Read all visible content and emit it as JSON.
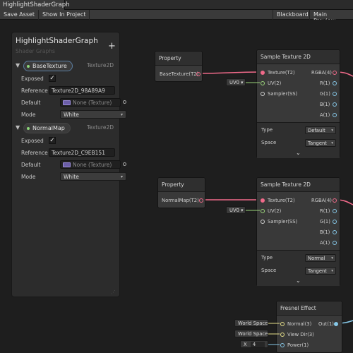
{
  "window": {
    "tab_title": "HighlightShaderGraph"
  },
  "toolbar": {
    "save_asset": "Save Asset",
    "show_in_project": "Show In Project",
    "blackboard": "Blackboard",
    "main_preview": "Main Preview"
  },
  "blackboard": {
    "title": "HighlightShaderGraph",
    "subtitle": "Shader Graphs",
    "add_glyph": "+",
    "properties": [
      {
        "name": "BaseTexture",
        "type": "Texture2D",
        "exposed_label": "Exposed",
        "exposed": true,
        "reference_label": "Reference",
        "reference": "Texture2D_98A89A9",
        "default_label": "Default",
        "default": "None (Texture)",
        "mode_label": "Mode",
        "mode": "White"
      },
      {
        "name": "NormalMap",
        "type": "Texture2D",
        "exposed_label": "Exposed",
        "exposed": true,
        "reference_label": "Reference",
        "reference": "Texture2D_C9EB151",
        "default_label": "Default",
        "default": "None (Texture)",
        "mode_label": "Mode",
        "mode": "White"
      }
    ]
  },
  "nodes": {
    "property1": {
      "title": "Property",
      "output": "BaseTexture(T2)"
    },
    "property2": {
      "title": "Property",
      "output": "NormalMap(T2)"
    },
    "sample1": {
      "title": "Sample Texture 2D",
      "inputs": [
        "Texture(T2)",
        "UV(2)",
        "Sampler(SS)"
      ],
      "outputs": [
        "RGBA(4)",
        "R(1)",
        "G(1)",
        "B(1)",
        "A(1)"
      ],
      "type_label": "Type",
      "type_value": "Default",
      "space_label": "Space",
      "space_value": "Tangent",
      "uv_input": "UV0"
    },
    "sample2": {
      "title": "Sample Texture 2D",
      "inputs": [
        "Texture(T2)",
        "UV(2)",
        "Sampler(SS)"
      ],
      "outputs": [
        "RGBA(4)",
        "R(1)",
        "G(1)",
        "B(1)",
        "A(1)"
      ],
      "type_label": "Type",
      "type_value": "Normal",
      "space_label": "Space",
      "space_value": "Tangent",
      "uv_input": "UV0"
    },
    "fresnel": {
      "title": "Fresnel Effect",
      "inputs": [
        "Normal(3)",
        "View Dir(3)",
        "Power(1)"
      ],
      "output": "Out(1)",
      "normal_input": "World Space",
      "viewdir_input": "World Space",
      "power_axis": "X",
      "power_value": "4"
    }
  },
  "colors": {
    "texture_port": "#f06a8a",
    "vector2_port": "#9ad47a",
    "vector3_port": "#e6e08a",
    "vector1_port": "#86c8e8",
    "property_dot": "#8cd67a"
  }
}
